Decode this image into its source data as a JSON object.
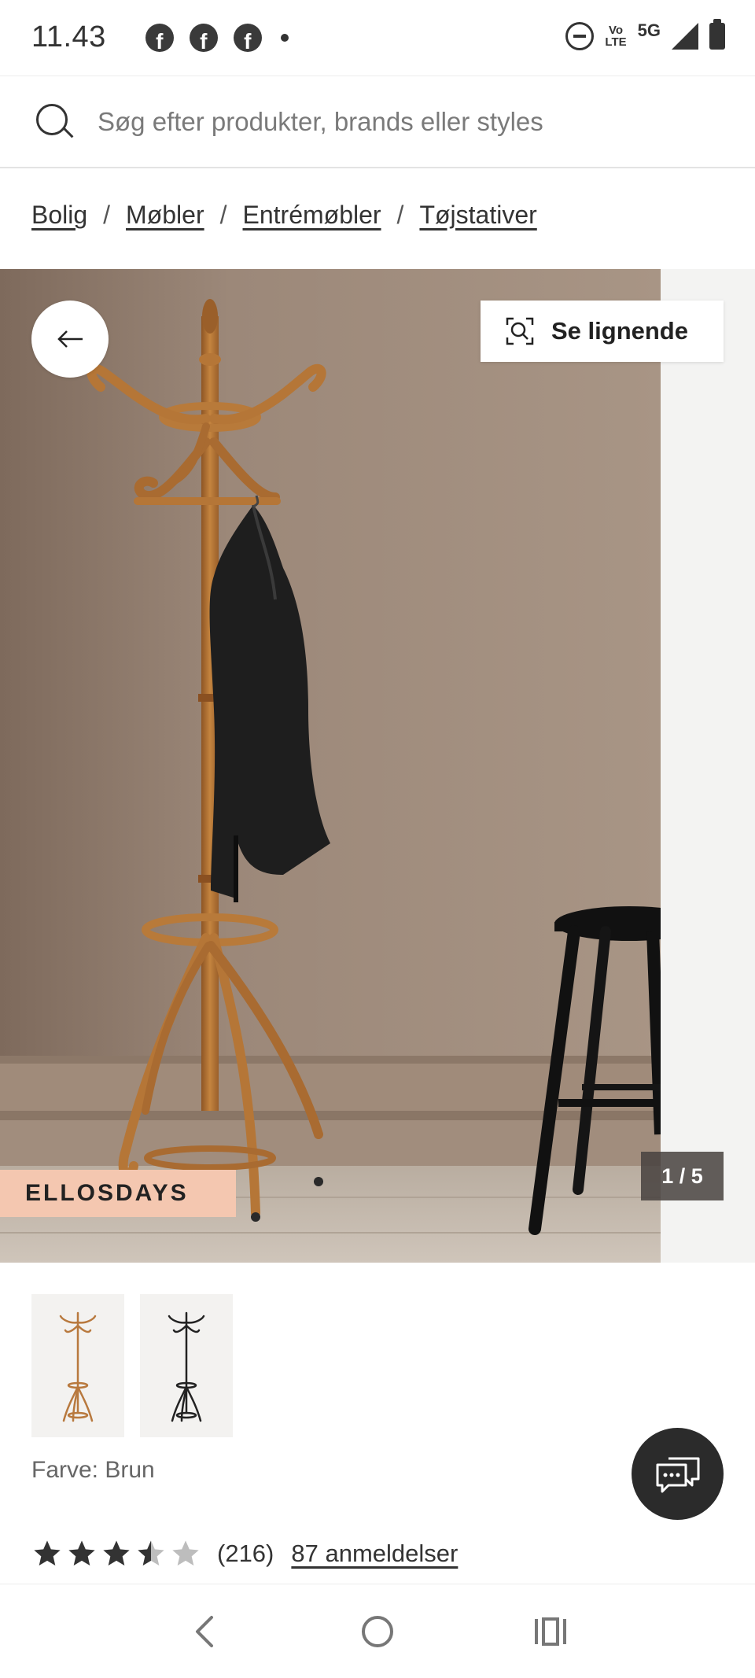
{
  "status_bar": {
    "time": "11.43",
    "app_icons": [
      "facebook-icon",
      "facebook-icon",
      "facebook-icon"
    ],
    "network_label_top": "Vo",
    "network_label_bottom": "LTE",
    "network_type": "5G"
  },
  "search": {
    "placeholder": "Søg efter produkter, brands eller styles"
  },
  "breadcrumb": {
    "items": [
      "Bolig",
      "Møbler",
      "Entrémøbler",
      "Tøjstativer"
    ],
    "separator": "/"
  },
  "gallery": {
    "similar_button_label": "Se lignende",
    "promo_badge": "ELLOSDAYS",
    "image_counter": "1 / 5"
  },
  "thumbnails": [
    {
      "variant": "Brun",
      "color": "#b8793e"
    },
    {
      "variant": "Sort",
      "color": "#222222"
    }
  ],
  "product": {
    "color_label": "Farve: Brun",
    "rating": 3.5,
    "rating_max": 5,
    "rating_count": "(216)",
    "reviews_link": "87 anmeldelser"
  },
  "colors": {
    "accent_promo": "#f4c7b0",
    "chat_button": "#2b2b2b",
    "star_filled": "#333333",
    "star_empty": "#bdbdbd"
  }
}
